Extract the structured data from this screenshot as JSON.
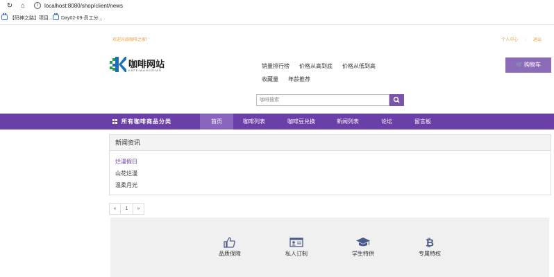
{
  "browser": {
    "url": "localhost:8080/shop/client/news",
    "bookmarks": [
      "【码神之路】项目...",
      "Day02-09-员工分..."
    ]
  },
  "topbar": {
    "welcome": "欢迎光临咖啡之家！",
    "user_center": "个人中心",
    "logout": "退出"
  },
  "logo": {
    "title": "咖啡网站",
    "subtitle": "KAFEIWANGZHAN"
  },
  "sort_links": [
    "销量排行榜",
    "价格从高到底",
    "价格从低到高",
    "收藏量",
    "年龄推荐"
  ],
  "cart": {
    "label": "购物车"
  },
  "search": {
    "placeholder": "咖啡搜索"
  },
  "category_nav": {
    "all_label": "所有咖啡商品分类",
    "items": [
      "首页",
      "咖啡列表",
      "咖啡豆兑换",
      "新闻列表",
      "论坛",
      "留言板"
    ],
    "active_index": 0
  },
  "news": {
    "heading": "新闻资讯",
    "items": [
      "烂漫假日",
      "山花烂漫",
      "温柔月光"
    ]
  },
  "pagination": {
    "prev": "«",
    "page": "1",
    "next": "»"
  },
  "features": [
    {
      "label": "品质保障",
      "icon": "thumbs-up-icon"
    },
    {
      "label": "私人订制",
      "icon": "id-card-icon"
    },
    {
      "label": "学生特供",
      "icon": "graduation-cap-icon"
    },
    {
      "label": "专属特权",
      "icon": "bitcoin-icon"
    }
  ],
  "colors": {
    "nav_bg": "#6a3fa8",
    "nav_active": "#8a65c0",
    "cart_bg": "#8c6bb8",
    "accent_link": "#6a3fa8",
    "welcome_text": "#e8a040"
  }
}
